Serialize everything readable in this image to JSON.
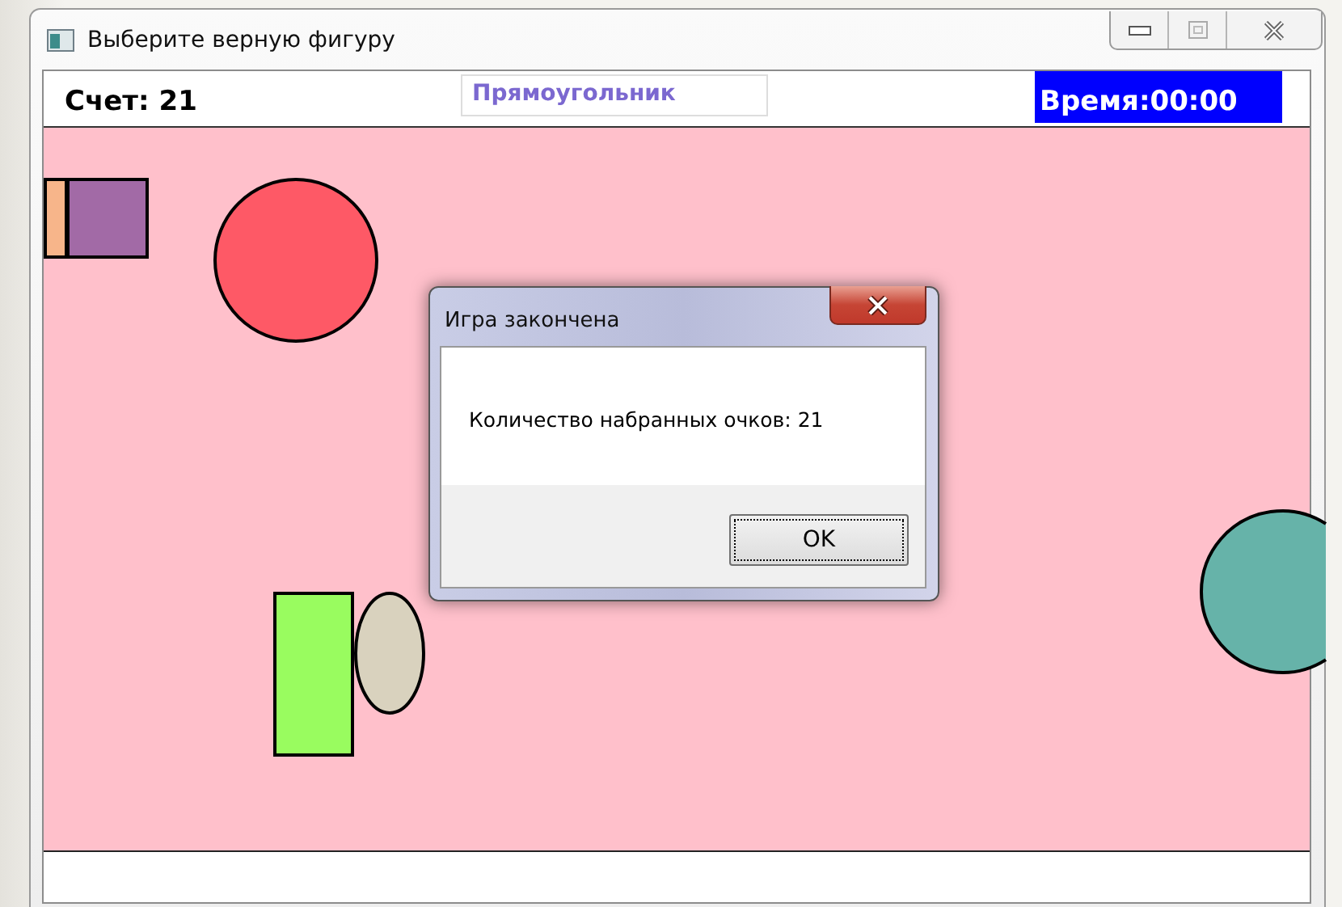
{
  "window": {
    "title": "Выберите верную фигуру"
  },
  "score": "Счет: 21",
  "target": "Прямоугольник",
  "timer": "Время:00:00",
  "shapes": [
    {
      "kind": "rect",
      "color": "#f7b58a"
    },
    {
      "kind": "rect",
      "color": "#a26aa6"
    },
    {
      "kind": "circle",
      "color": "#fe5966"
    },
    {
      "kind": "rect",
      "color": "#99fc5f"
    },
    {
      "kind": "ellipse",
      "color": "#d9d2be"
    },
    {
      "kind": "circle",
      "color": "#66b3a9"
    }
  ],
  "dialog": {
    "title": "Игра закончена",
    "message": "Количество набранных очков: 21",
    "button": "OK"
  }
}
